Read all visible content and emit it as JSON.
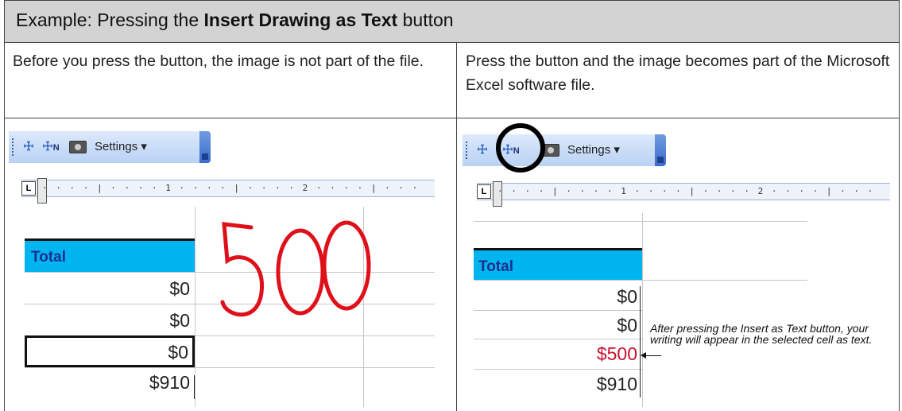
{
  "header": {
    "prefix": "Example: Pressing the ",
    "bold": "Insert Drawing as Text",
    "suffix": " button"
  },
  "columns": {
    "left_description": "Before you press the button, the image is not part of the file.",
    "right_description": "Press the button and the image becomes part of the Microsoft Excel software file."
  },
  "toolbar": {
    "settings_label": "Settings ▾",
    "insert_icon_text": "☩",
    "insert_text_icon_sub": "N"
  },
  "ruler": {
    "left_marker": "L",
    "ticks": "· · · · | · · · · 1 · · · · | · · · · 2 · · · · | · · ·"
  },
  "spreadsheet_left": {
    "header": "Total",
    "values": [
      "$0",
      "$0",
      "$0",
      "$910"
    ],
    "handwriting": "500"
  },
  "spreadsheet_right": {
    "header": "Total",
    "values": [
      "$0",
      "$0",
      "$500",
      "$910"
    ]
  },
  "note": "After pressing the Insert as Text button, your writing will appear in the selected cell as text.",
  "colors": {
    "header_bg": "#d3d3d3",
    "total_bg": "#00b4f0",
    "ink_red": "#e0101a",
    "converted_red": "#c8102e"
  }
}
